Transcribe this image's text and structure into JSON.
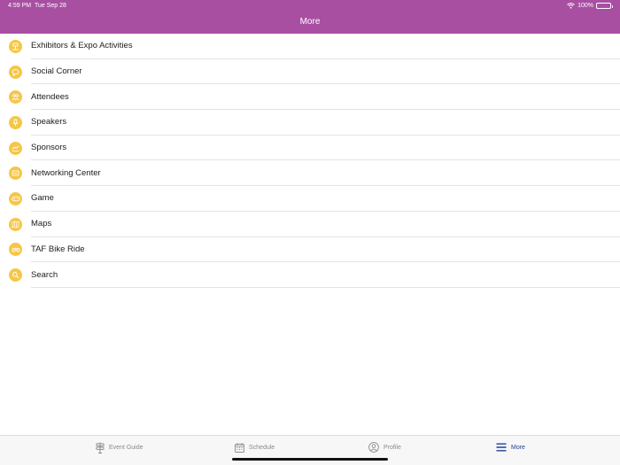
{
  "status_bar": {
    "time": "4:59 PM",
    "date": "Tue Sep 28",
    "battery_percent": "100%",
    "icons": [
      "wifi-icon",
      "battery-icon"
    ]
  },
  "header": {
    "title": "More"
  },
  "menu": {
    "items": [
      {
        "label": "Exhibitors & Expo Activities",
        "icon": "exhibitors-icon"
      },
      {
        "label": "Social Corner",
        "icon": "social-corner-icon"
      },
      {
        "label": "Attendees",
        "icon": "attendees-icon"
      },
      {
        "label": "Speakers",
        "icon": "speakers-icon"
      },
      {
        "label": "Sponsors",
        "icon": "sponsors-icon"
      },
      {
        "label": "Networking Center",
        "icon": "networking-icon"
      },
      {
        "label": "Game",
        "icon": "game-icon"
      },
      {
        "label": "Maps",
        "icon": "maps-icon"
      },
      {
        "label": "TAF Bike Ride",
        "icon": "bike-ride-icon"
      },
      {
        "label": "Search",
        "icon": "search-icon"
      }
    ]
  },
  "tabbar": {
    "tabs": [
      {
        "label": "Event Guide",
        "icon": "signpost-icon",
        "active": false
      },
      {
        "label": "Schedule",
        "icon": "calendar-icon",
        "active": false
      },
      {
        "label": "Profile",
        "icon": "profile-icon",
        "active": false
      },
      {
        "label": "More",
        "icon": "menu-icon",
        "active": true
      }
    ]
  },
  "colors": {
    "header": "#a84fa2",
    "icon_badge": "#f7c646",
    "tab_active": "#1f3f8f",
    "tab_inactive": "#8a8a8e"
  }
}
